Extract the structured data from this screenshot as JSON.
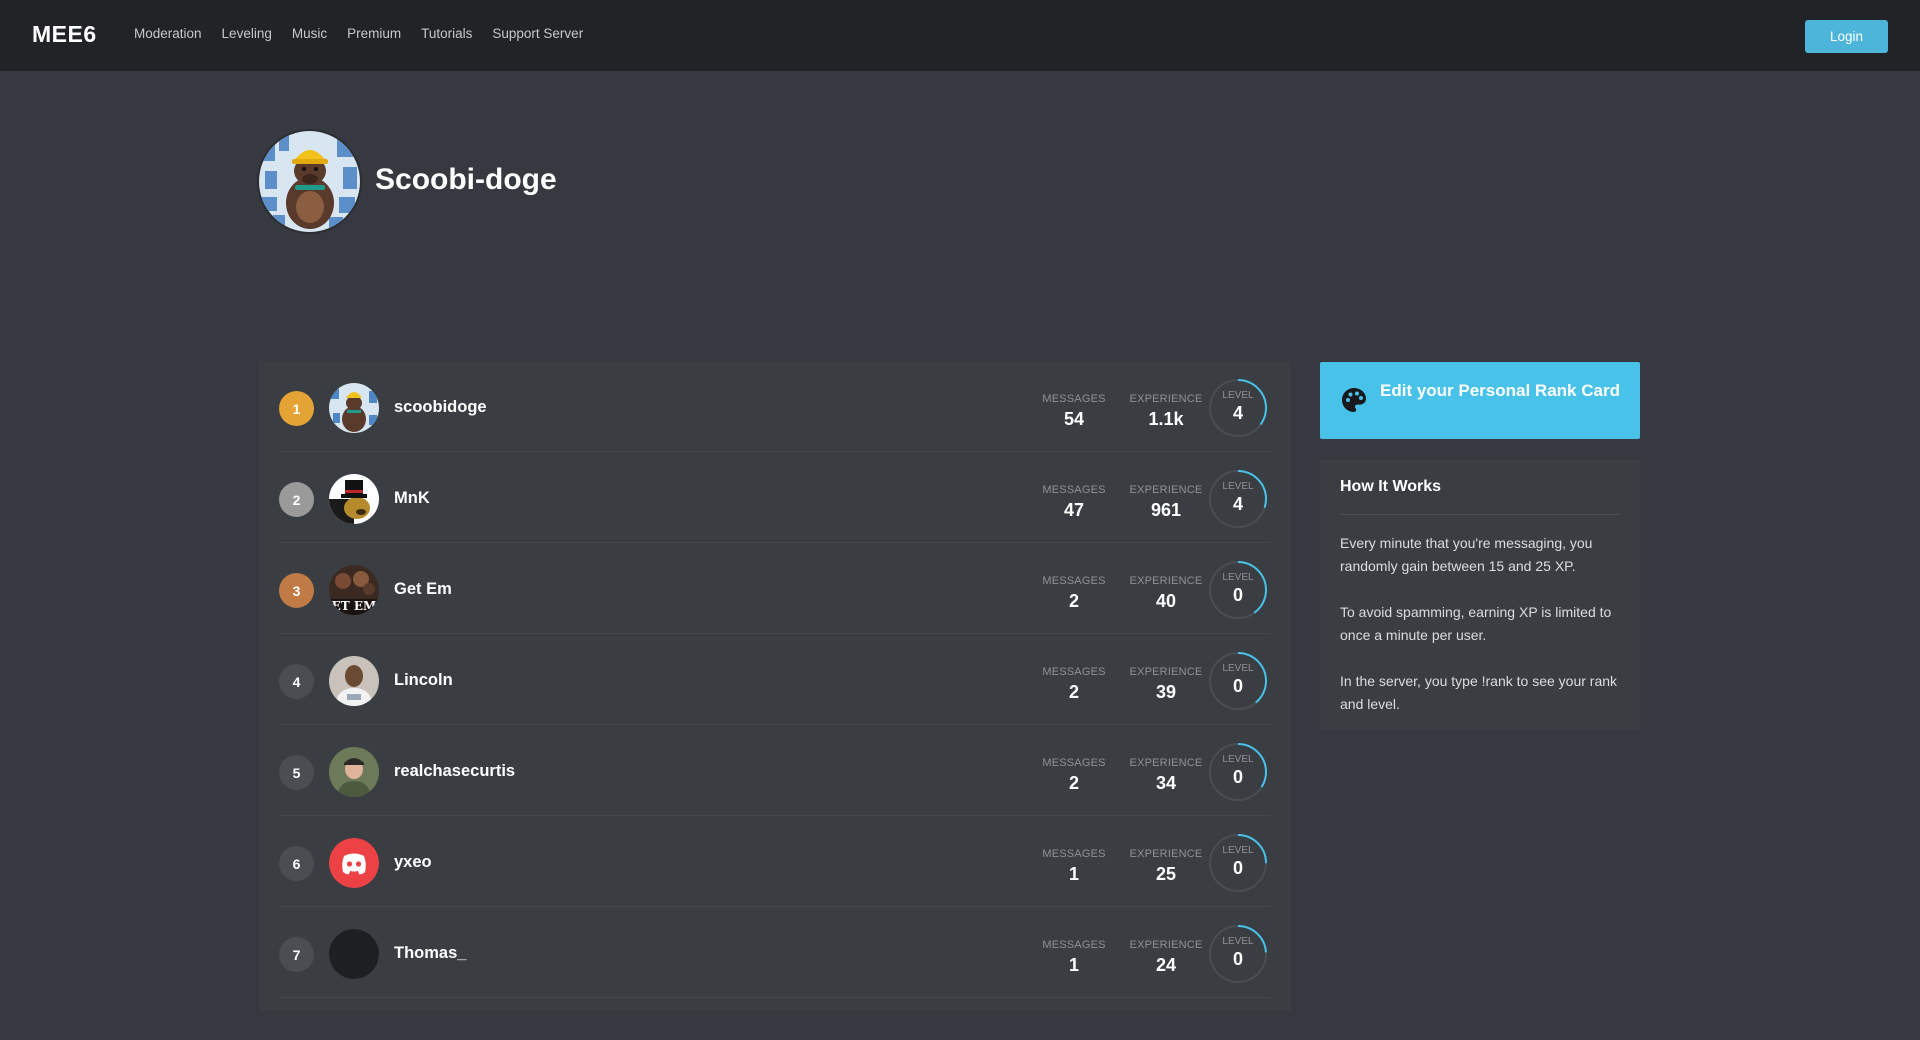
{
  "nav": {
    "brand": "MEE6",
    "links": [
      "Moderation",
      "Leveling",
      "Music",
      "Premium",
      "Tutorials",
      "Support Server"
    ],
    "login_label": "Login"
  },
  "header": {
    "server_name": "Scoobi-doge"
  },
  "leaderboard": {
    "messages_label": "MESSAGES",
    "experience_label": "EXPERIENCE",
    "level_label": "LEVEL",
    "rows": [
      {
        "rank": "1",
        "name": "scoobidoge",
        "messages": "54",
        "experience": "1.1k",
        "level": "4",
        "badge_color": "#e3a335",
        "avatar": "doge-icon",
        "level_progress": 0.35
      },
      {
        "rank": "2",
        "name": "MnK",
        "messages": "47",
        "experience": "961",
        "level": "4",
        "badge_color": "#9a9a9a",
        "avatar": "tophat-bear-icon",
        "level_progress": 0.3
      },
      {
        "rank": "3",
        "name": "Get Em",
        "messages": "2",
        "experience": "40",
        "level": "0",
        "badge_color": "#c07a45",
        "avatar": "get-em-icon",
        "level_progress": 0.4
      },
      {
        "rank": "4",
        "name": "Lincoln",
        "messages": "2",
        "experience": "39",
        "level": "0",
        "badge_color": "#4a4d52",
        "avatar": "person-icon",
        "level_progress": 0.39
      },
      {
        "rank": "5",
        "name": "realchasecurtis",
        "messages": "2",
        "experience": "34",
        "level": "0",
        "badge_color": "#4a4d52",
        "avatar": "person-cap-icon",
        "level_progress": 0.34
      },
      {
        "rank": "6",
        "name": "yxeo",
        "messages": "1",
        "experience": "25",
        "level": "0",
        "badge_color": "#4a4d52",
        "avatar": "discord-icon",
        "level_progress": 0.25
      },
      {
        "rank": "7",
        "name": "Thomas_",
        "messages": "1",
        "experience": "24",
        "level": "0",
        "badge_color": "#4a4d52",
        "avatar": "blank-avatar-icon",
        "level_progress": 0.24
      }
    ]
  },
  "sidebar": {
    "edit_card_title": "Edit your Personal Rank Card",
    "how_title": "How It Works",
    "how_paragraphs": [
      "Every minute that you're messaging, you randomly gain between 15 and 25 XP.",
      "To avoid spamming, earning XP is limited to once a minute per user.",
      "In the server, you type !rank to see your rank and level."
    ]
  },
  "colors": {
    "accent": "#48c2e9",
    "background": "#36393f",
    "nav": "#222326",
    "card": "#3a3d42",
    "ring_track": "#4a4d52",
    "ring_fill": "#48c2e9"
  }
}
